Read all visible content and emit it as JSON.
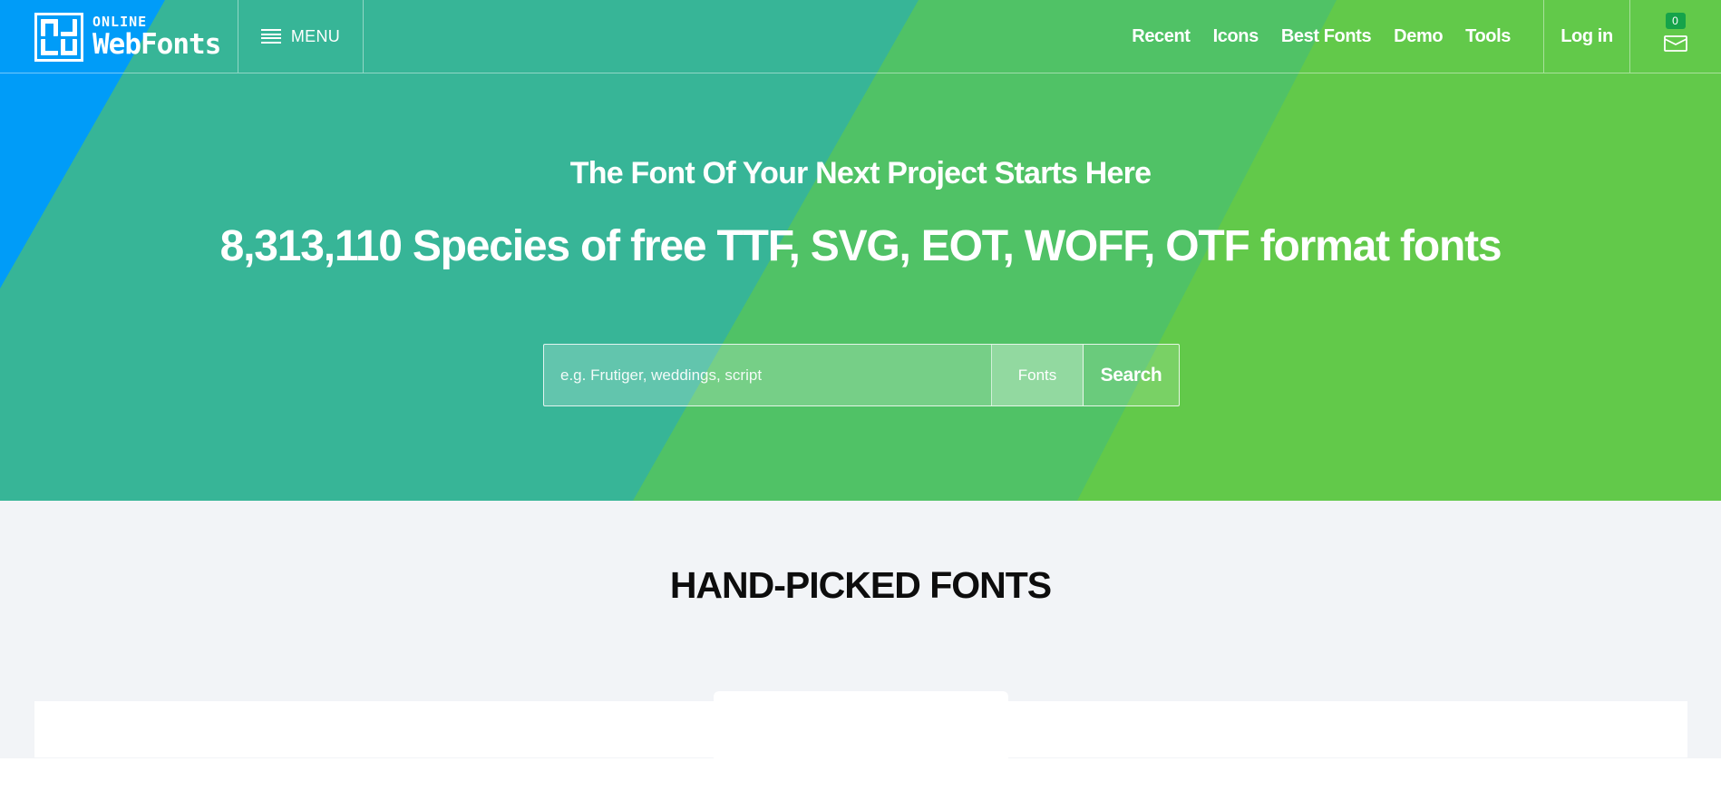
{
  "brand": {
    "logo_small": "ONLINE",
    "logo_big": "WebFonts"
  },
  "nav": {
    "menu_label": "MENU",
    "links": [
      "Recent",
      "Icons",
      "Best Fonts",
      "Demo",
      "Tools"
    ],
    "login_label": "Log in",
    "cart_count": "0"
  },
  "hero": {
    "subtitle": "The Font Of Your Next Project Starts Here",
    "title": "8,313,110 Species of free TTF, SVG, EOT, WOFF, OTF format fonts"
  },
  "search": {
    "placeholder": "e.g. Frutiger, weddings, script",
    "type_label": "Fonts",
    "button_label": "Search"
  },
  "section": {
    "title": "HAND-PICKED FONTS"
  },
  "colors": {
    "blue": "#009cf8",
    "teal": "#37b597",
    "green": "#50c266",
    "lime": "#62c94a",
    "section_bg": "#f2f4f7"
  }
}
